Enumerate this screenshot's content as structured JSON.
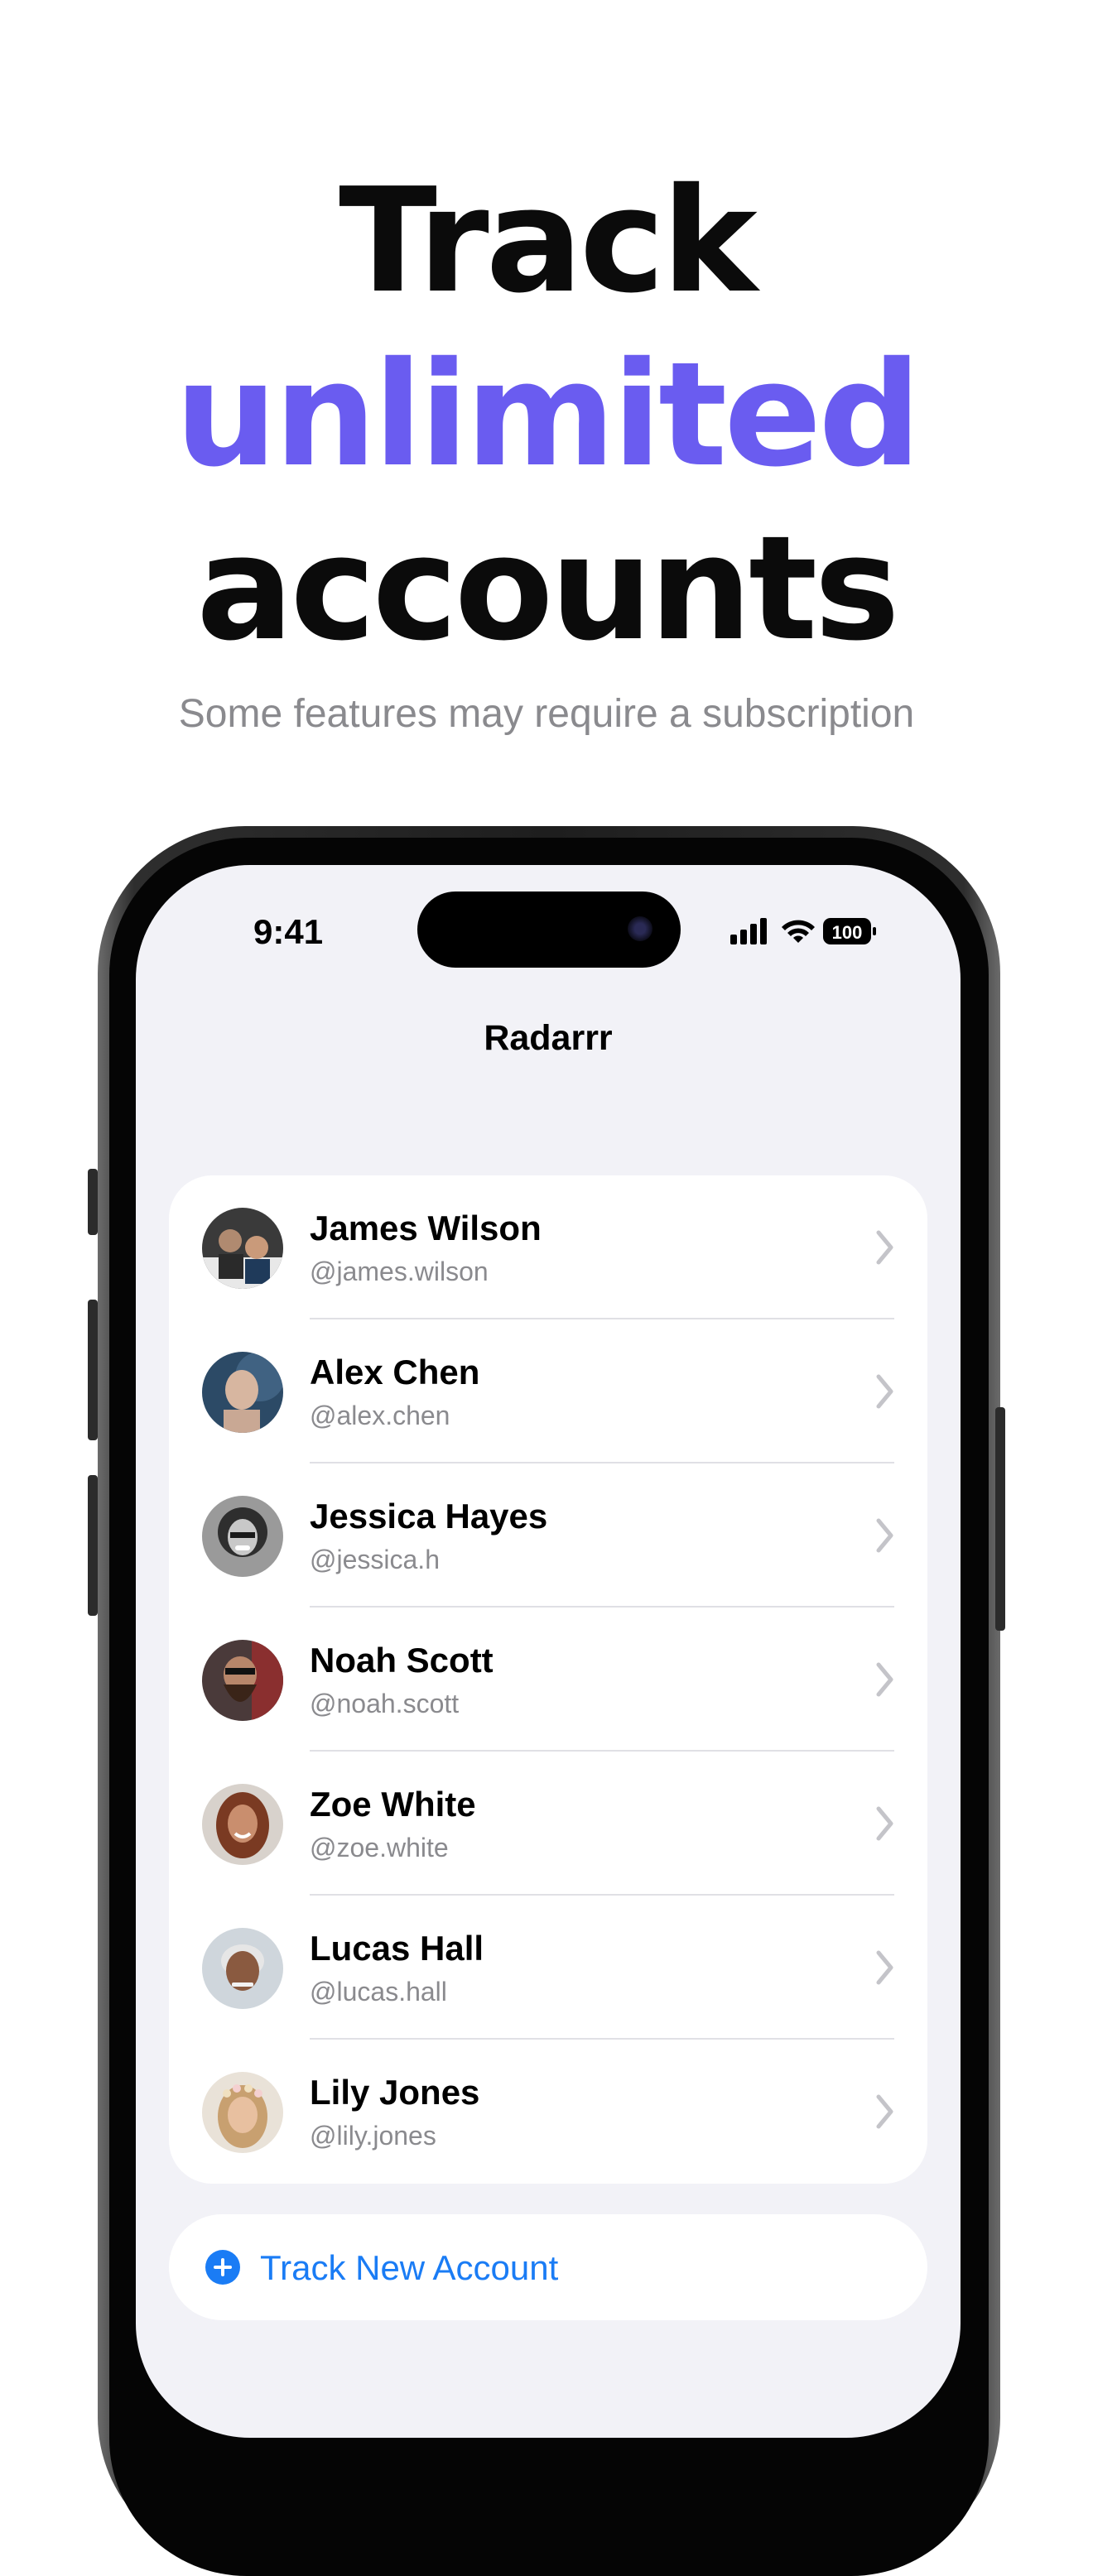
{
  "headline": {
    "line1": "Track",
    "line2": "unlimited",
    "line3": "accounts",
    "subtitle": "Some features may require a subscription",
    "accent_color": "#6a5cf0"
  },
  "status_bar": {
    "time": "9:41",
    "battery": "100",
    "icons": [
      "signal-icon",
      "wifi-icon",
      "battery-icon"
    ]
  },
  "nav": {
    "title": "Radarrr"
  },
  "accounts": [
    {
      "name": "James Wilson",
      "handle": "@james.wilson"
    },
    {
      "name": "Alex Chen",
      "handle": "@alex.chen"
    },
    {
      "name": "Jessica Hayes",
      "handle": "@jessica.h"
    },
    {
      "name": "Noah Scott",
      "handle": "@noah.scott"
    },
    {
      "name": "Zoe White",
      "handle": "@zoe.white"
    },
    {
      "name": "Lucas Hall",
      "handle": "@lucas.hall"
    },
    {
      "name": "Lily Jones",
      "handle": "@lily.jones"
    }
  ],
  "actions": {
    "track_new_label": "Track New Account",
    "link_color": "#1a7cf5"
  }
}
